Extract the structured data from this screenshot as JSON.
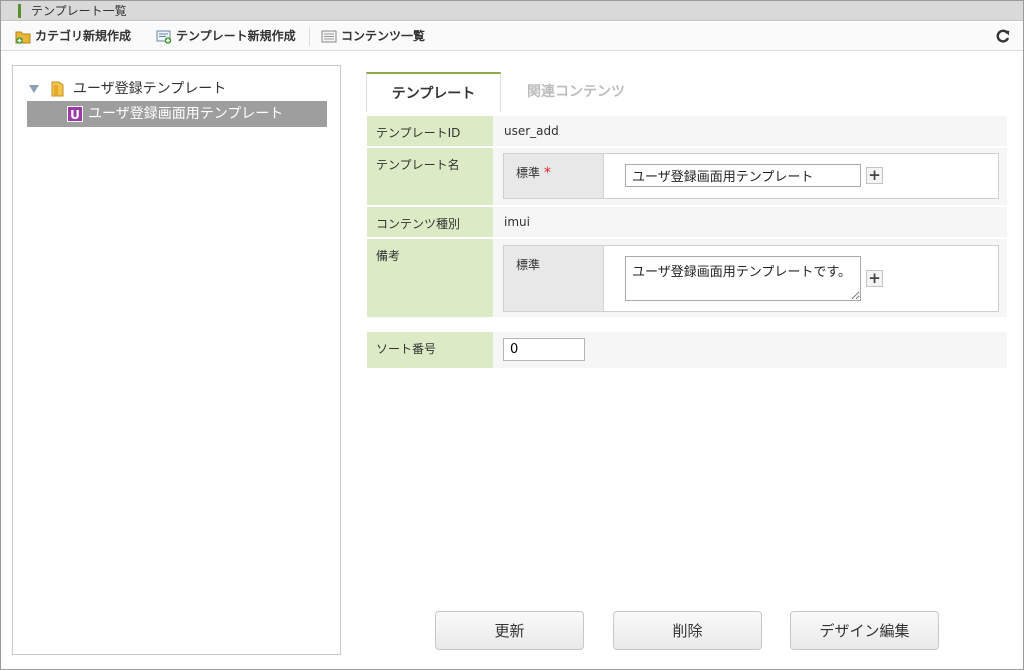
{
  "window": {
    "title": "テンプレート一覧"
  },
  "toolbar": {
    "new_category": "カテゴリ新規作成",
    "new_template": "テンプレート新規作成",
    "content_list": "コンテンツ一覧"
  },
  "tree": {
    "root_label": "ユーザ登録テンプレート",
    "child_badge": "U",
    "child_label": "ユーザ登録画面用テンプレート"
  },
  "tabs": [
    {
      "label": "テンプレート",
      "active": true
    },
    {
      "label": "関連コンテンツ",
      "active": false
    }
  ],
  "form": {
    "template_id_label": "テンプレートID",
    "template_id_value": "user_add",
    "template_name_label": "テンプレート名",
    "template_name_lang": "標準",
    "template_name_required": "*",
    "template_name_value": "ユーザ登録画面用テンプレート",
    "content_type_label": "コンテンツ種別",
    "content_type_value": "imui",
    "remarks_label": "備考",
    "remarks_lang": "標準",
    "remarks_value": "ユーザ登録画面用テンプレートです。",
    "sort_label": "ソート番号",
    "sort_value": "0",
    "plus": "+"
  },
  "actions": {
    "update": "更新",
    "delete": "削除",
    "design_edit": "デザイン編集"
  }
}
